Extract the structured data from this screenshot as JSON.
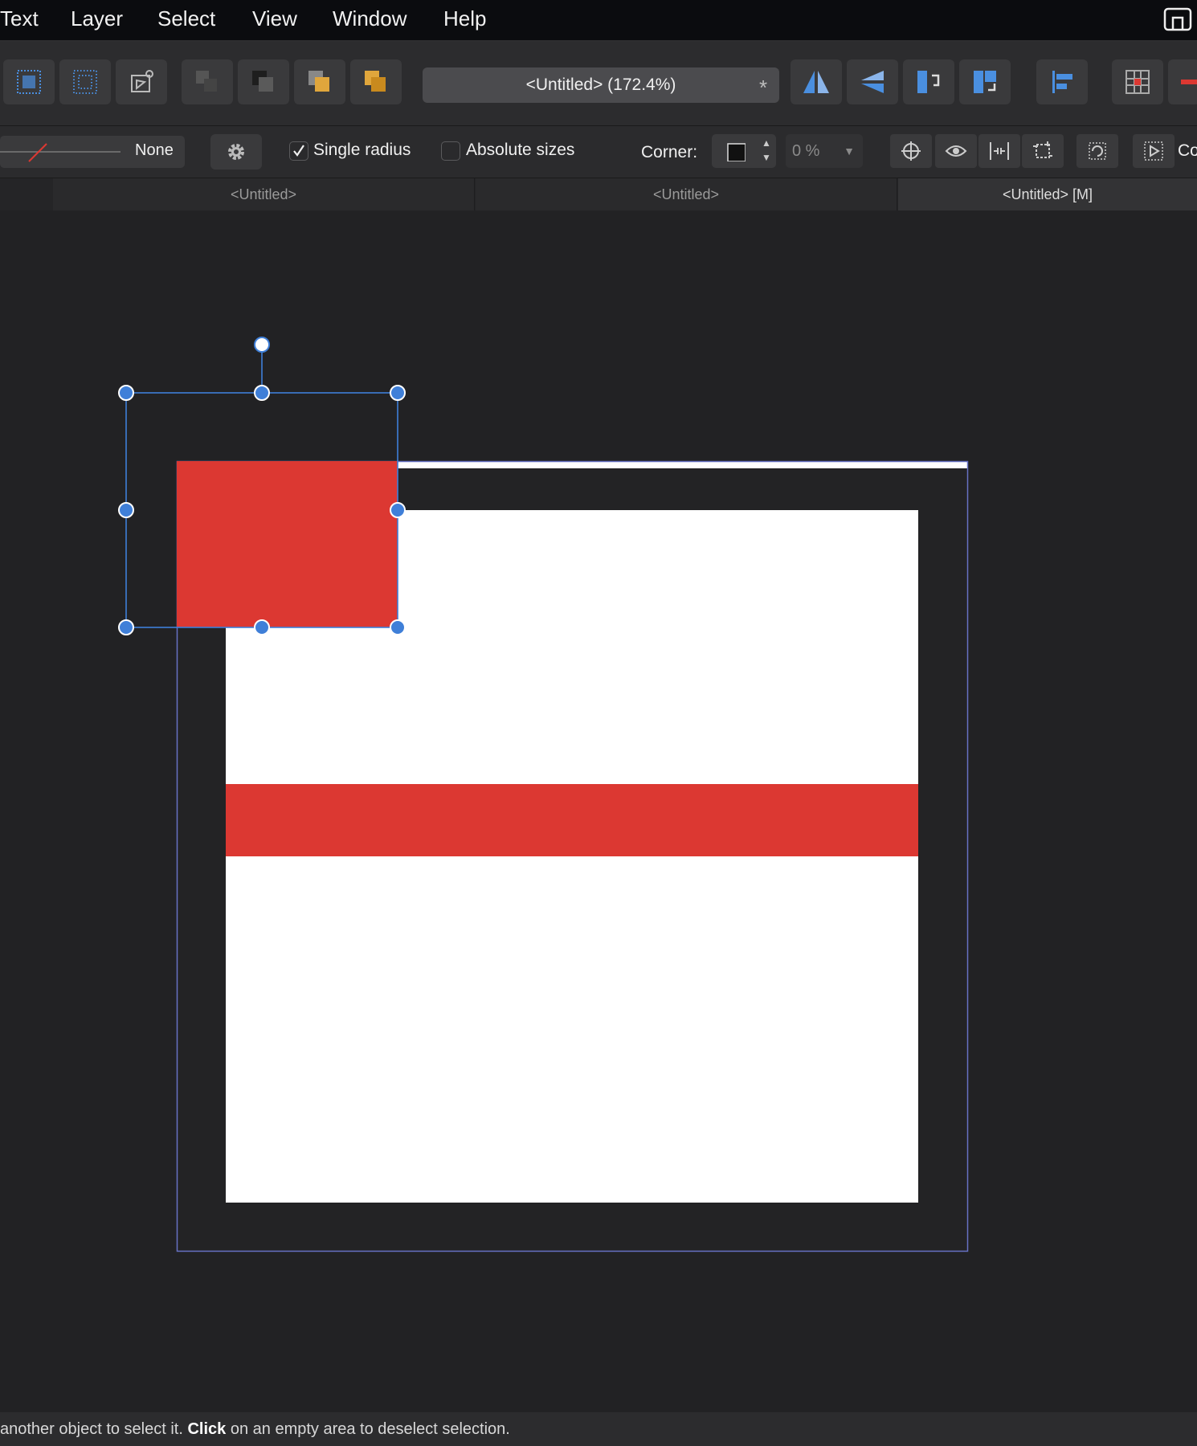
{
  "menu": {
    "items": [
      "Text",
      "Layer",
      "Select",
      "View",
      "Window",
      "Help"
    ]
  },
  "toolbar": {
    "document_title": "<Untitled> (172.4%)",
    "modified_marker": "*"
  },
  "context_toolbar": {
    "line_style_value": "None",
    "single_radius_label": "Single radius",
    "single_radius_checked": true,
    "absolute_sizes_label": "Absolute sizes",
    "absolute_sizes_checked": false,
    "corner_label": "Corner:",
    "corner_amount": "0 %",
    "truncated_label": "Co"
  },
  "tabs": [
    {
      "label": "<Untitled>",
      "active": false
    },
    {
      "label": "<Untitled>",
      "active": false
    },
    {
      "label": "<Untitled> [M]",
      "active": true
    }
  ],
  "status_bar": {
    "text_before": "another object to select it. ",
    "bold_1": "Click",
    "text_after": " on an empty area to deselect selection."
  },
  "colors": {
    "accent_red": "#dc3832",
    "selection_blue": "#3f7fd8",
    "artboard_white": "#ffffff",
    "canvas_bg": "#222224"
  },
  "icons": {
    "menubar_right": "screen-share-icon"
  }
}
